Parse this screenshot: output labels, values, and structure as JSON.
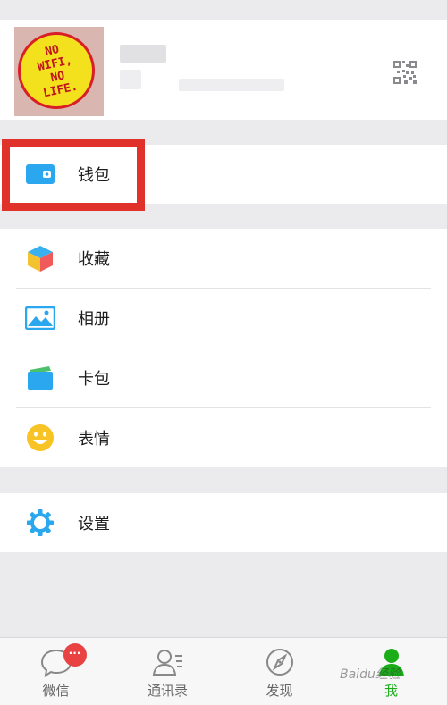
{
  "profile": {
    "avatar_text": "NO\nWIFI,\nNO\nLIFE."
  },
  "menu": {
    "wallet": "钱包",
    "favorites": "收藏",
    "album": "相册",
    "cards": "卡包",
    "stickers": "表情",
    "settings": "设置"
  },
  "tabbar": {
    "chats": "微信",
    "chats_badge": "···",
    "contacts": "通讯录",
    "discover": "发现",
    "me": "我"
  },
  "watermark": "Baidu经验",
  "colors": {
    "accent_green": "#1aad19",
    "wallet_blue": "#2aa7ee",
    "highlight_red": "#e0322b",
    "badge_red": "#e94242"
  },
  "icons": {
    "wallet": "wallet-icon",
    "favorites": "cube-icon",
    "album": "picture-icon",
    "cards": "card-icon",
    "stickers": "smiley-icon",
    "settings": "gear-icon",
    "qr": "qr-code-icon"
  }
}
